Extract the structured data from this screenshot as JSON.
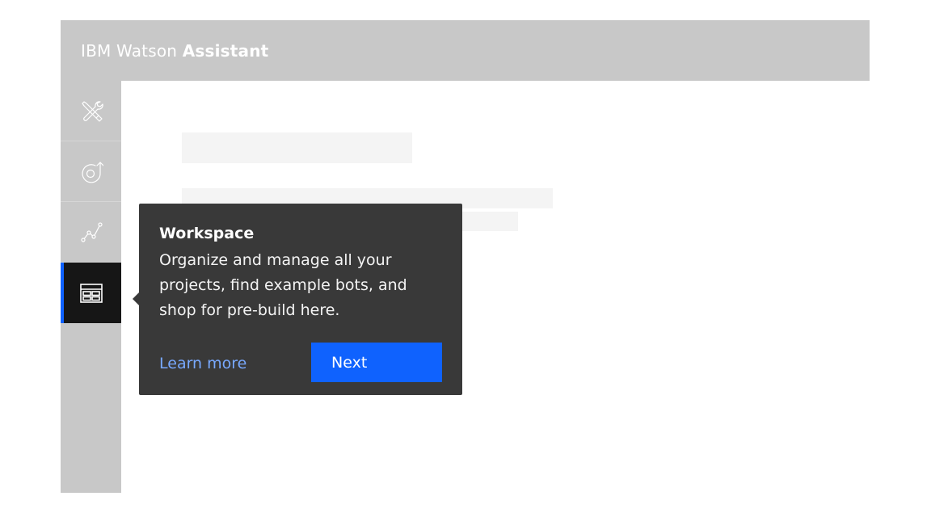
{
  "header": {
    "brand_prefix": "IBM Watson ",
    "brand_product": "Assistant"
  },
  "sidebar": {
    "items": [
      {
        "name": "tools",
        "icon": "tools-icon",
        "active": false
      },
      {
        "name": "skills",
        "icon": "cycle-arrow-icon",
        "active": false
      },
      {
        "name": "analytics",
        "icon": "chart-line-icon",
        "active": false
      },
      {
        "name": "workspace",
        "icon": "workspace-icon",
        "active": true
      }
    ]
  },
  "tooltip": {
    "title": "Workspace",
    "body": "Organize and manage all your projects, find example bots, and shop for pre-build here.",
    "learn_more_label": "Learn more",
    "next_label": "Next"
  },
  "colors": {
    "header_bg": "#c8c8c8",
    "active_item_bg": "#161616",
    "accent": "#0f62fe",
    "tooltip_bg": "#393939",
    "link": "#78a9ff",
    "skeleton": "#f4f4f4"
  }
}
